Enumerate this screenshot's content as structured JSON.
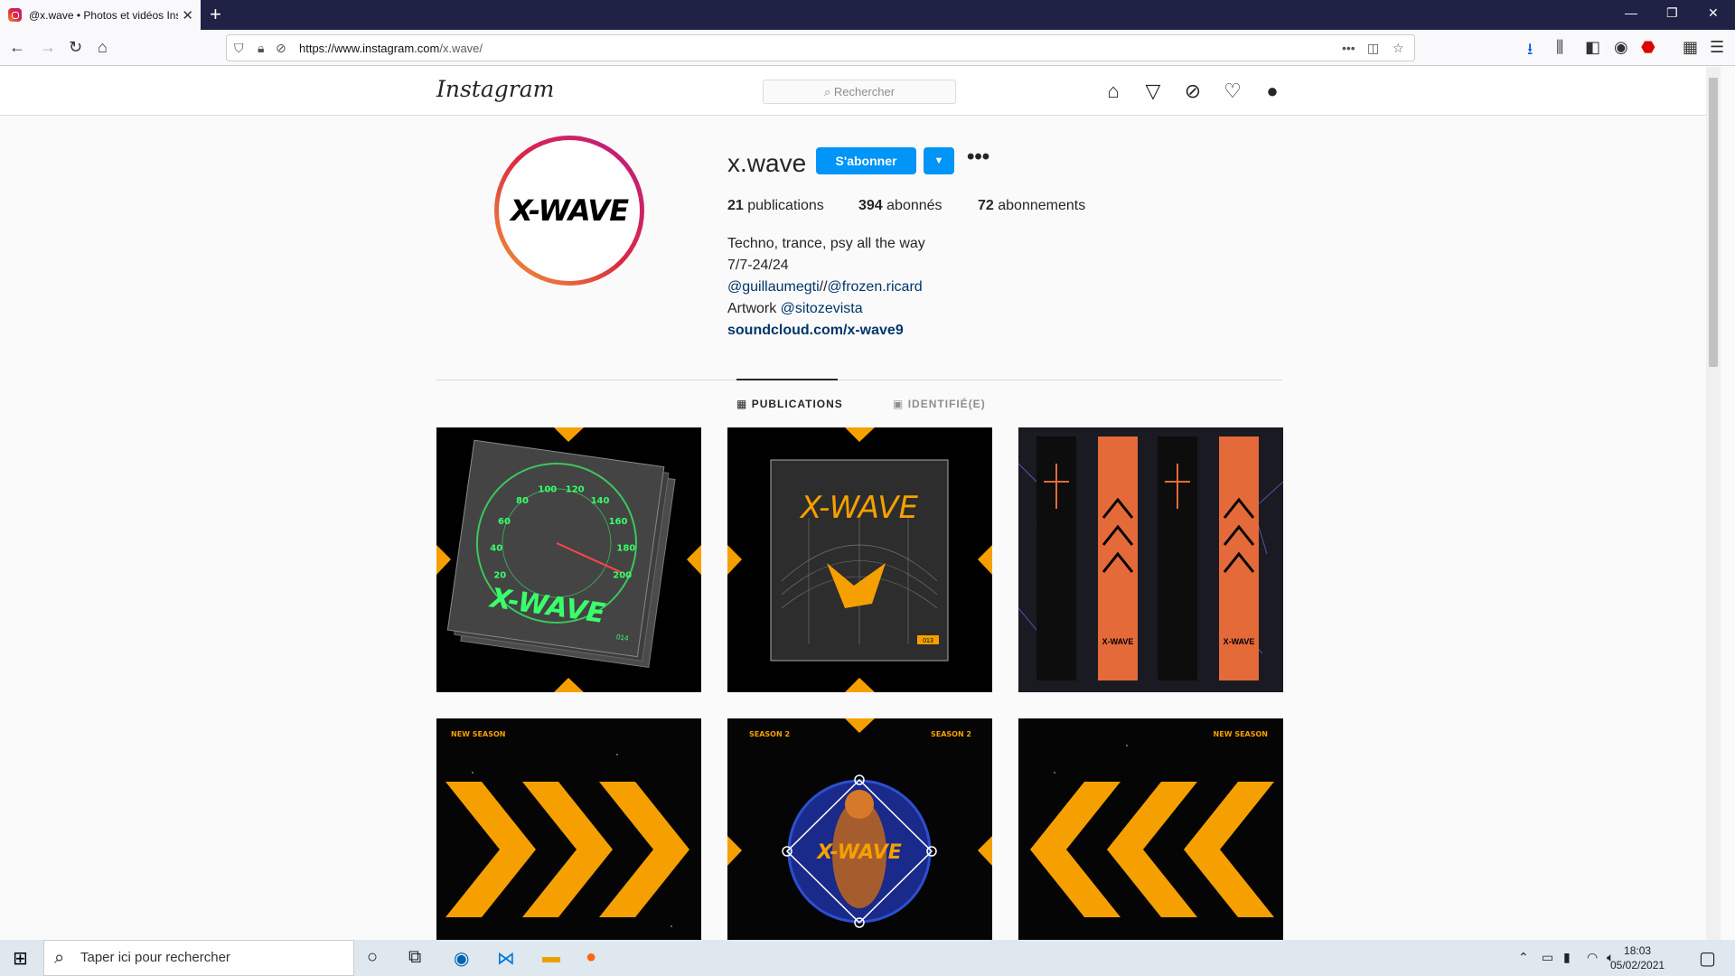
{
  "browser": {
    "tab_title": "@x.wave • Photos et vidéos Ins",
    "url_prefix": "https://www.instagram.com",
    "url_path": "/x.wave/"
  },
  "ig": {
    "logo": "Instagram",
    "search_placeholder": "Rechercher"
  },
  "profile": {
    "username": "x.wave",
    "follow_label": "S'abonner",
    "more_label": "•••",
    "stats": {
      "posts_count": "21",
      "posts_label": "publications",
      "followers_count": "394",
      "followers_label": "abonnés",
      "following_count": "72",
      "following_label": "abonnements"
    },
    "bio": {
      "line1": "Techno, trance, psy all the way",
      "line2": "7/7-24/24",
      "mention1": "@guillaumegti",
      "sep": "//",
      "mention2": "@frozen.ricard",
      "artwork_prefix": "Artwork ",
      "mention3": "@sitozevista",
      "website": "soundcloud.com/x-wave9"
    },
    "avatar_text": "X-WAVE"
  },
  "tabs": {
    "posts": "PUBLICATIONS",
    "tagged": "IDENTIFIÉ(E)"
  },
  "posts": [
    {
      "caption": "X-WAVE",
      "speed_labels": [
        "20",
        "40",
        "60",
        "80",
        "100",
        "120",
        "140",
        "160",
        "180",
        "200"
      ],
      "badge": "014"
    },
    {
      "caption": "X-WAVE",
      "badge": "013"
    },
    {
      "caption": "X-WAVE"
    },
    {
      "caption": "NEW SEASON"
    },
    {
      "caption_left": "SEASON 2",
      "caption_right": "SEASON 2",
      "center": "X-WAVE"
    },
    {
      "caption": "NEW SEASON"
    }
  ],
  "taskbar": {
    "search_placeholder": "Taper ici pour rechercher",
    "time": "18:03",
    "date": "05/02/2021"
  },
  "colors": {
    "accent": "#0095f6",
    "orange": "#f5a000",
    "neon_green": "#39ff6a"
  }
}
